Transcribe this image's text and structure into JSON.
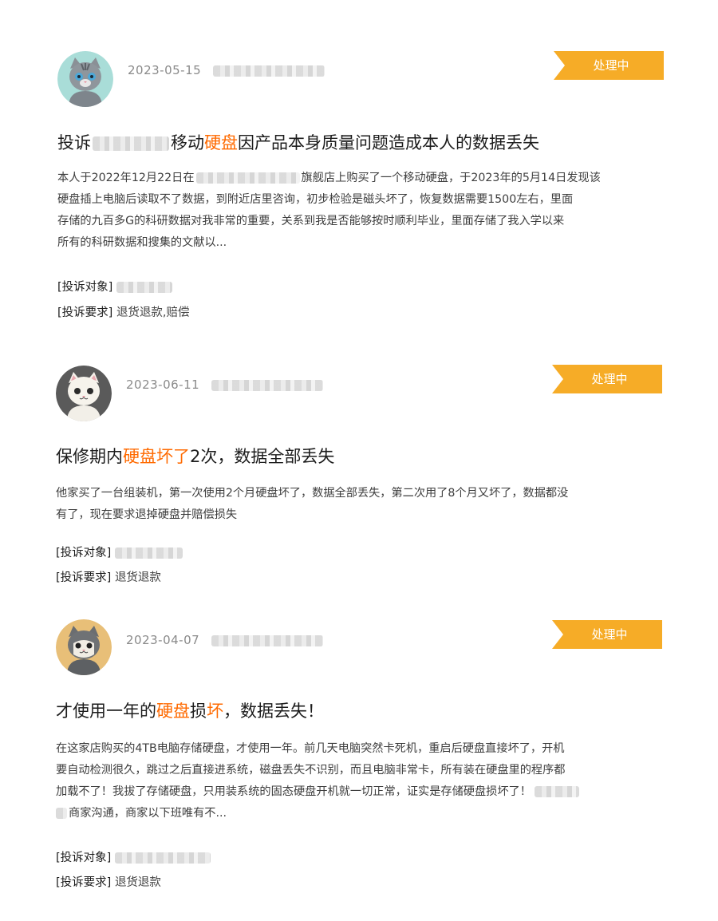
{
  "status_label": "处理中",
  "complaint_target_label": "[投诉对象]",
  "complaint_request_label": "[投诉要求]",
  "complaints": [
    {
      "date": "2023-05-15",
      "avatar": "gray-tabby-cat-icon",
      "title_parts": [
        {
          "text": "投诉",
          "hl": false
        },
        {
          "text": "移动",
          "hl": false
        },
        {
          "text": "硬盘",
          "hl": true
        },
        {
          "text": "因产品本身质量问题造成本人的数据丢失",
          "hl": false
        }
      ],
      "body_lines": [
        {
          "a": "本人于2022年12月22日在",
          "b": "旗舰店上购买了一个移动硬盘，于2023年的5月14日发现该"
        },
        {
          "a": "硬盘插上电脑后读取不了数据，到附近店里咨询，初步检验是磁头坏了，恢复数据需要1500左右，里面",
          "b": ""
        },
        {
          "a": "存储的九百多G的科研数据对我非常的重要，关系到我是否能够按时顺利毕业，里面存储了我入学以来",
          "b": ""
        },
        {
          "a": "所有的科研数据和搜集的文献以...",
          "b": ""
        }
      ],
      "request": "退货退款,赔偿"
    },
    {
      "date": "2023-06-11",
      "avatar": "white-cat-icon",
      "title_parts": [
        {
          "text": "保修期内",
          "hl": false
        },
        {
          "text": "硬盘坏了",
          "hl": true
        },
        {
          "text": "2次，数据全部丢失",
          "hl": false
        }
      ],
      "body_lines": [
        {
          "a": "他家买了一台组装机，第一次使用2个月硬盘坏了，数据全部丢失，第二次用了8个月又坏了，数据都没",
          "b": ""
        },
        {
          "a": "有了，现在要求退掉硬盘并赔偿损失",
          "b": ""
        }
      ],
      "request": "退货退款"
    },
    {
      "date": "2023-04-07",
      "avatar": "gray-cat-tan-background-icon",
      "title_parts": [
        {
          "text": "才使用一年的",
          "hl": false
        },
        {
          "text": "硬盘",
          "hl": true
        },
        {
          "text": "损",
          "hl": false
        },
        {
          "text": "坏",
          "hl": true
        },
        {
          "text": "，数据丢失！",
          "hl": false
        }
      ],
      "body_lines": [
        {
          "a": "在这家店购买的4TB电脑存储硬盘，才使用一年。前几天电脑突然卡死机，重启后硬盘直接坏了，开机",
          "b": ""
        },
        {
          "a": "要自动检测很久，跳过之后直接进系统，磁盘丢失不识别，而且电脑非常卡，所有装在硬盘里的程序都",
          "b": ""
        },
        {
          "a": "加载不了！我拔了存储硬盘，只用装系统的固态硬盘开机就一切正常，证实是存储硬盘损坏了！",
          "b": ""
        },
        {
          "a": "商家沟通，商家以下班唯有不...",
          "b": ""
        }
      ],
      "request": "退货退款"
    }
  ],
  "colors": {
    "accent_orange": "#ff6a00",
    "status_yellow": "#f6ac27",
    "date_gray": "#8a8a8a"
  }
}
